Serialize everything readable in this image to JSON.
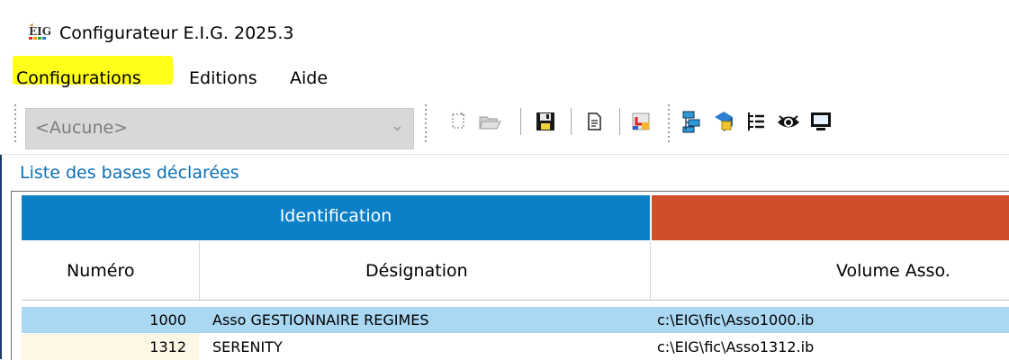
{
  "window": {
    "title": "Configurateur E.I.G. 2025.3"
  },
  "menu": {
    "items": [
      "Configurations",
      "Editions",
      "Aide"
    ]
  },
  "toolbar": {
    "combo_value": "<Aucune>",
    "tools": [
      "new-icon",
      "open-folder-icon",
      "save-icon",
      "document-icon",
      "import-icon",
      "network-icon",
      "layers-icon",
      "tree-list-icon",
      "eye-icon",
      "monitor-icon"
    ]
  },
  "list": {
    "label": "Liste des bases déclarées",
    "group_header": "Identification",
    "columns": {
      "numero": "Numéro",
      "designation": "Désignation",
      "volume": "Volume Asso."
    },
    "rows": [
      {
        "numero": "1000",
        "designation": "Asso GESTIONNAIRE REGIMES",
        "volume": "c:\\EIG\\fic\\Asso1000.ib"
      },
      {
        "numero": "1312",
        "designation": "SERENITY",
        "volume": "c:\\EIG\\fic\\Asso1312.ib"
      }
    ]
  },
  "colors": {
    "highlight": "#ffff1a",
    "group_identification": "#0b80c6",
    "group_second": "#d14e2a",
    "selected_row": "#aad8f3",
    "label_blue": "#0a6fb7"
  }
}
